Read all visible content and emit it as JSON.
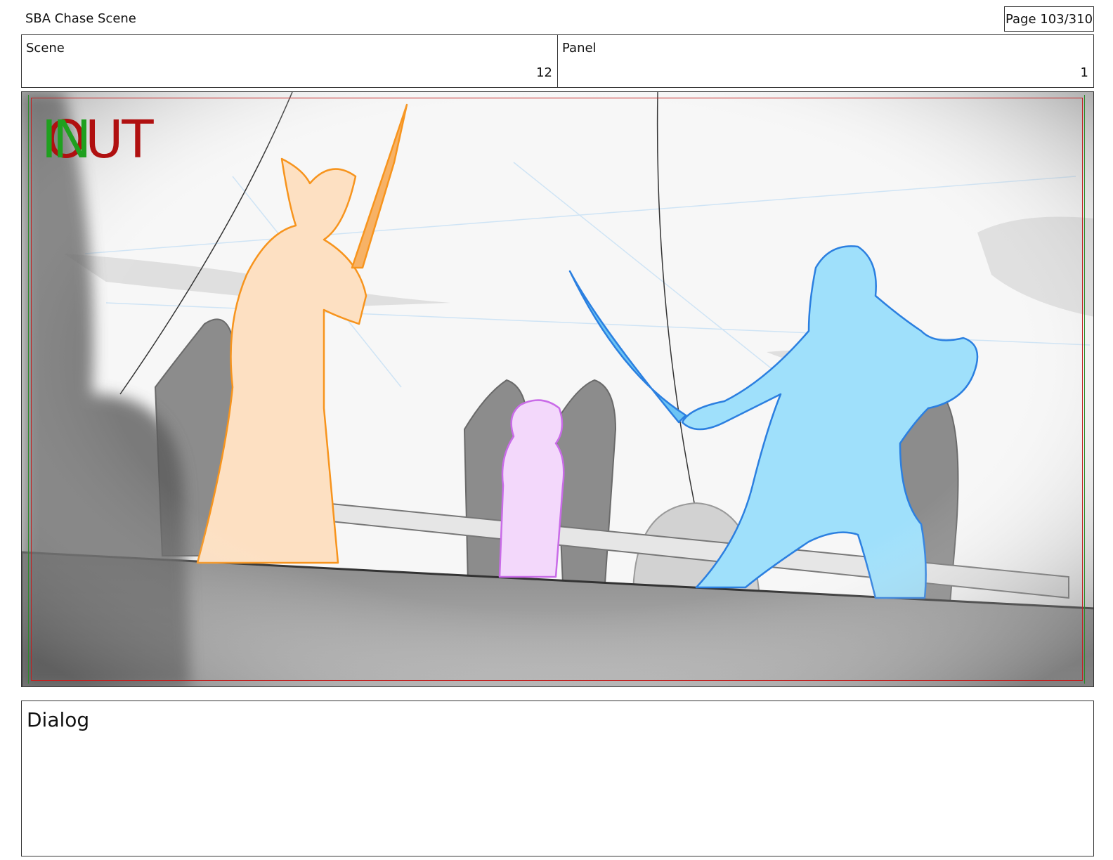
{
  "header": {
    "document_title": "SBA Chase Scene",
    "page_indicator": "Page 103/310"
  },
  "info": {
    "scene_label": "Scene",
    "scene_value": "12",
    "panel_label": "Panel",
    "panel_value": "1"
  },
  "frame": {
    "in_marker": "IN",
    "out_marker": "OUT",
    "colors": {
      "safe_red": "#c32020",
      "safe_green": "#2a8a2a",
      "left_figure": "#f7941d",
      "right_figure": "#2b7fe0",
      "center_figure": "#c96be8"
    }
  },
  "dialog": {
    "label": "Dialog"
  }
}
